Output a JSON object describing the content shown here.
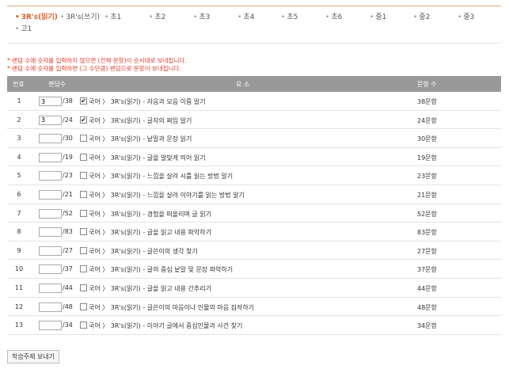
{
  "tabs": [
    {
      "label": "3R's(읽기)",
      "active": true
    },
    {
      "label": "3R's(쓰기)",
      "active": false
    },
    {
      "label": "초1",
      "active": false
    },
    {
      "label": "초2",
      "active": false
    },
    {
      "label": "초3",
      "active": false
    },
    {
      "label": "초4",
      "active": false
    },
    {
      "label": "초5",
      "active": false
    },
    {
      "label": "초6",
      "active": false
    },
    {
      "label": "중1",
      "active": false
    },
    {
      "label": "중2",
      "active": false
    },
    {
      "label": "중3",
      "active": false
    },
    {
      "label": "고1",
      "active": false
    }
  ],
  "notes": [
    "* 랜덤 수에 숫자를 입력하지 않으면 (전체 문항)이 순서대로 보내집니다.",
    "* 랜덤 수에 숫자를 입력하면 (그 수만큼) 랜덤으로 문항이 보내집니다."
  ],
  "table": {
    "headers": {
      "num": "번호",
      "random": "랜덤수",
      "element": "요 소",
      "count": "문항 수"
    },
    "rows": [
      {
        "num": "1",
        "value": "3",
        "total": "/38",
        "checked": true,
        "element": "국어 〉 3R's(읽기) - 자음과 모음 이름 알기",
        "count": "38문항"
      },
      {
        "num": "2",
        "value": "3",
        "total": "/24",
        "checked": true,
        "element": "국어 〉 3R's(읽기) - 글자의 짜임 알기",
        "count": "24문항"
      },
      {
        "num": "3",
        "value": "",
        "total": "/30",
        "checked": false,
        "element": "국어 〉 3R's(읽기) - 낱말과 문장 읽기",
        "count": "30문항"
      },
      {
        "num": "4",
        "value": "",
        "total": "/19",
        "checked": false,
        "element": "국어 〉 3R's(읽기) - 글을 알맞게 띄어 읽기",
        "count": "19문항"
      },
      {
        "num": "5",
        "value": "",
        "total": "/23",
        "checked": false,
        "element": "국어 〉 3R's(읽기) - 느낌을 살려 시를 읽는 방법 알기",
        "count": "23문항"
      },
      {
        "num": "6",
        "value": "",
        "total": "/21",
        "checked": false,
        "element": "국어 〉 3R's(읽기) - 느낌을 살려 이야기를 읽는 방법 알기",
        "count": "21문항"
      },
      {
        "num": "7",
        "value": "",
        "total": "/52",
        "checked": false,
        "element": "국어 〉 3R's(읽기) - 경험을 떠올리며 글 읽기",
        "count": "52문항"
      },
      {
        "num": "8",
        "value": "",
        "total": "/83",
        "checked": false,
        "element": "국어 〉 3R's(읽기) - 글을 읽고 내용 파악하기",
        "count": "83문항"
      },
      {
        "num": "9",
        "value": "",
        "total": "/27",
        "checked": false,
        "element": "국어 〉 3R's(읽기) - 글쓴이의 생각 찾기",
        "count": "27문항"
      },
      {
        "num": "10",
        "value": "",
        "total": "/37",
        "checked": false,
        "element": "국어 〉 3R's(읽기) - 글의 중심 낱말 및 문장 파악하기",
        "count": "37문항"
      },
      {
        "num": "11",
        "value": "",
        "total": "/44",
        "checked": false,
        "element": "국어 〉 3R's(읽기) - 글을 읽고 내용 간추리기",
        "count": "44문항"
      },
      {
        "num": "12",
        "value": "",
        "total": "/48",
        "checked": false,
        "element": "국어 〉 3R's(읽기) - 글쓴이의 마음이나 인물의 마음 짐작하기",
        "count": "48문항"
      },
      {
        "num": "13",
        "value": "",
        "total": "/34",
        "checked": false,
        "element": "국어 〉 3R's(읽기) - 이야기 글에서 중심인물과 사건 찾기",
        "count": "34문항"
      }
    ]
  },
  "submit_label": "학습주제 보내기",
  "colors": {
    "accent": "#e05a1e",
    "note": "#e23a2a",
    "header_bg": "#999999"
  }
}
